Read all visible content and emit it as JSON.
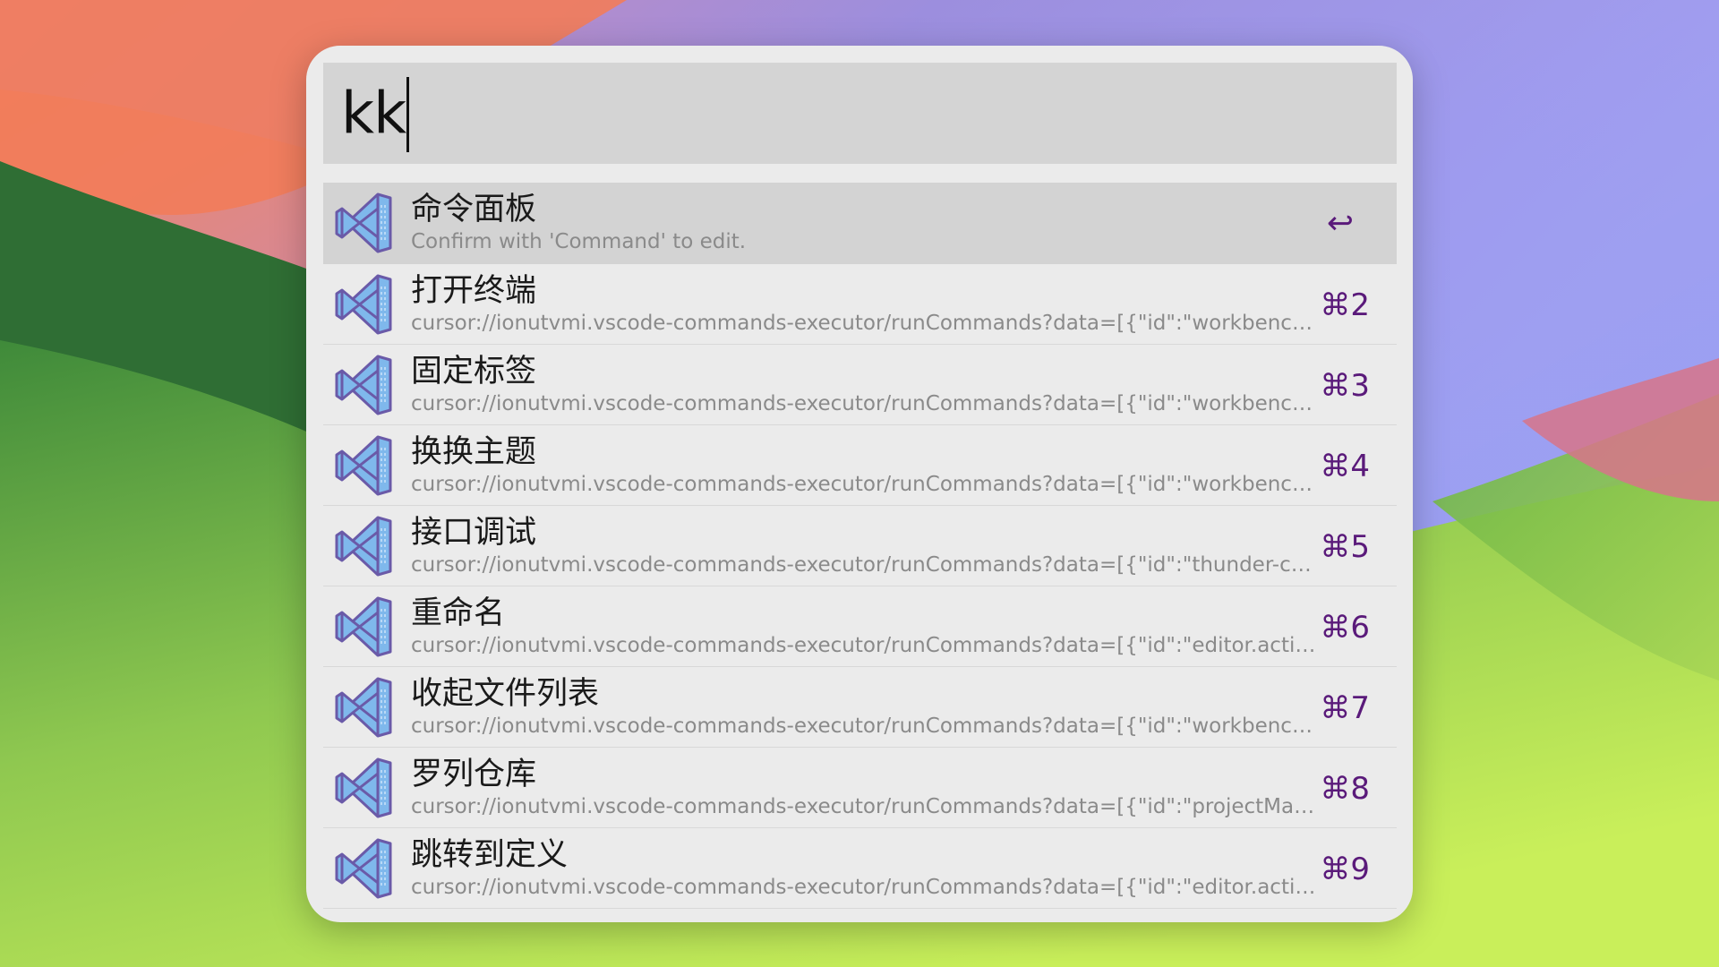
{
  "search": {
    "query": "kk"
  },
  "results": [
    {
      "title": "命令面板",
      "subtitle": "Confirm with 'Command' to edit.",
      "shortcut": "↩",
      "icon": "vscode-icon",
      "selected": true
    },
    {
      "title": "打开终端",
      "subtitle": "cursor://ionutvmi.vscode-commands-executor/runCommands?data=[{\"id\":\"workbench.…",
      "shortcut": "⌘2",
      "icon": "vscode-icon"
    },
    {
      "title": "固定标签",
      "subtitle": "cursor://ionutvmi.vscode-commands-executor/runCommands?data=[{\"id\":\"workbench.…",
      "shortcut": "⌘3",
      "icon": "vscode-icon"
    },
    {
      "title": "换换主题",
      "subtitle": "cursor://ionutvmi.vscode-commands-executor/runCommands?data=[{\"id\":\"workbench.…",
      "shortcut": "⌘4",
      "icon": "vscode-icon"
    },
    {
      "title": "接口调试",
      "subtitle": "cursor://ionutvmi.vscode-commands-executor/runCommands?data=[{\"id\":\"thunder-clie…",
      "shortcut": "⌘5",
      "icon": "vscode-icon"
    },
    {
      "title": "重命名",
      "subtitle": "cursor://ionutvmi.vscode-commands-executor/runCommands?data=[{\"id\":\"editor.action…",
      "shortcut": "⌘6",
      "icon": "vscode-icon"
    },
    {
      "title": "收起文件列表",
      "subtitle": "cursor://ionutvmi.vscode-commands-executor/runCommands?data=[{\"id\":\"workbench.f…",
      "shortcut": "⌘7",
      "icon": "vscode-icon"
    },
    {
      "title": "罗列仓库",
      "subtitle": "cursor://ionutvmi.vscode-commands-executor/runCommands?data=[{\"id\":\"projectMana…",
      "shortcut": "⌘8",
      "icon": "vscode-icon"
    },
    {
      "title": "跳转到定义",
      "subtitle": "cursor://ionutvmi.vscode-commands-executor/runCommands?data=[{\"id\":\"editor.action…",
      "shortcut": "⌘9",
      "icon": "vscode-icon"
    }
  ],
  "colors": {
    "panel_bg": "#ebebeb",
    "search_bg": "#d4d4d4",
    "selected_row_bg": "#d3d3d3",
    "shortcut_color": "#5a1a7a",
    "subtitle_color": "#8a8a8a",
    "icon_fill": "#7fb8ec",
    "icon_stroke": "#6a5aa8"
  }
}
